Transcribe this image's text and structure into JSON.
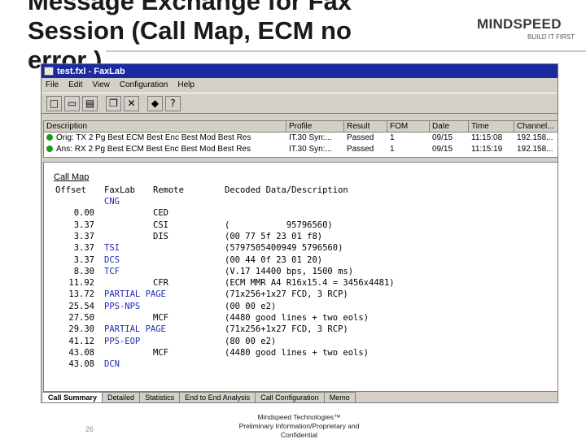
{
  "slide": {
    "title": "Message Exchange for Fax\nSession (Call Map, ECM no\nerror )",
    "logo_word": "MINDSPEED",
    "logo_tagline": "BUILD IT FIRST",
    "page_number": "26",
    "footer": "Mindspeed Technologies™\nPreliminary Information/Proprietary and\nConfidential"
  },
  "window": {
    "title": "test.fxl - FaxLab",
    "menu": [
      "File",
      "Edit",
      "View",
      "Configuration",
      "Help"
    ],
    "toolbar_icons": [
      "new-icon",
      "open-icon",
      "print-icon",
      "copy-icon",
      "delete-icon",
      "book-icon",
      "help-icon"
    ]
  },
  "session_list": {
    "columns": [
      "Description",
      "Profile",
      "Result",
      "FOM",
      "Date",
      "Time",
      "Channel..."
    ],
    "rows": [
      {
        "status_color": "#1a9a1a",
        "description": "Orig: TX 2 Pg Best ECM Best Enc Best Mod Best Res",
        "profile": "IT.30 Syn:...",
        "result": "Passed",
        "fom": "1",
        "date": "09/15",
        "time": "11:15:08",
        "channel": "192.158..."
      },
      {
        "status_color": "#1a9a1a",
        "description": "Ans: RX 2 Pg Best ECM Best Enc Best Mod Best Res",
        "profile": "IT.30 Syn:...",
        "result": "Passed",
        "fom": "1",
        "date": "09/15",
        "time": "11:15:19",
        "channel": "192.158..."
      }
    ]
  },
  "call_map": {
    "title": "Call Map",
    "headers": {
      "offset": "Offset",
      "faxlab": "FaxLab",
      "remote": "Remote",
      "decoded": "Decoded Data/Description"
    },
    "rows": [
      {
        "offset": "",
        "faxlab": "CNG",
        "remote": "",
        "decoded": ""
      },
      {
        "offset": "0.00",
        "faxlab": "",
        "remote": "CED",
        "decoded": ""
      },
      {
        "offset": "3.37",
        "faxlab": "",
        "remote": "CSI",
        "decoded": "(           95796560)"
      },
      {
        "offset": "3.37",
        "faxlab": "",
        "remote": "DIS",
        "decoded": "(00 77 5f 23 01 f8)"
      },
      {
        "offset": "3.37",
        "faxlab": "TSI",
        "remote": "",
        "decoded": "(5797505400949 5796560)"
      },
      {
        "offset": "3.37",
        "faxlab": "DCS",
        "remote": "",
        "decoded": "(00 44 0f 23 01 20)"
      },
      {
        "offset": "8.30",
        "faxlab": "TCF",
        "remote": "",
        "decoded": "(V.17 14400 bps, 1500 ms)"
      },
      {
        "offset": "11.92",
        "faxlab": "",
        "remote": "CFR",
        "decoded": "(ECM MMR A4 R16x15.4 = 3456x4481)"
      },
      {
        "offset": "13.72",
        "faxlab": "PARTIAL PAGE",
        "remote": "",
        "decoded": "(71x256+1x27 FCD, 3 RCP)"
      },
      {
        "offset": "25.54",
        "faxlab": "PPS-NPS",
        "remote": "",
        "decoded": "(00 00 e2)"
      },
      {
        "offset": "27.50",
        "faxlab": "",
        "remote": "MCF",
        "decoded": "(4480 good lines + two eols)"
      },
      {
        "offset": "29.30",
        "faxlab": "PARTIAL PAGE",
        "remote": "",
        "decoded": "(71x256+1x27 FCD, 3 RCP)"
      },
      {
        "offset": "41.12",
        "faxlab": "PPS-EOP",
        "remote": "",
        "decoded": "(80 00 e2)"
      },
      {
        "offset": "43.08",
        "faxlab": "",
        "remote": "MCF",
        "decoded": "(4480 good lines + two eols)"
      },
      {
        "offset": "43.08",
        "faxlab": "DCN",
        "remote": "",
        "decoded": ""
      }
    ]
  },
  "tabs": [
    {
      "label": "Call Summary",
      "active": true
    },
    {
      "label": "Detailed",
      "active": false
    },
    {
      "label": "Statistics",
      "active": false
    },
    {
      "label": "End to End Analysis",
      "active": false
    },
    {
      "label": "Call Configuration",
      "active": false
    },
    {
      "label": "Memo",
      "active": false
    }
  ]
}
